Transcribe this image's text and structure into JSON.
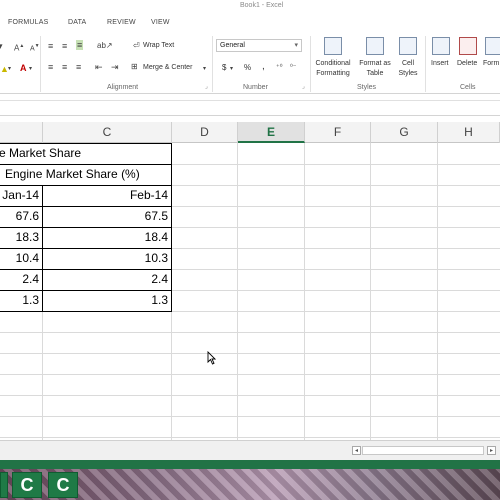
{
  "window": {
    "title": "Book1 - Excel"
  },
  "tabs": [
    "FORMULAS",
    "DATA",
    "REVIEW",
    "VIEW"
  ],
  "ribbon": {
    "alignment": {
      "wrap_text": "Wrap Text",
      "merge_center": "Merge & Center",
      "group_label": "Alignment"
    },
    "number": {
      "format_value": "General",
      "currency": "$",
      "percent": "%",
      "comma": ",",
      "group_label": "Number"
    },
    "styles": {
      "conditional_formatting": [
        "Conditional",
        "Formatting"
      ],
      "format_as_table": [
        "Format as",
        "Table"
      ],
      "cell_styles": [
        "Cell",
        "Styles"
      ],
      "group_label": "Styles"
    },
    "cells": {
      "insert": "Insert",
      "delete": "Delete",
      "format": "Form",
      "group_label": "Cells"
    }
  },
  "columns": [
    "C",
    "D",
    "E",
    "F",
    "G",
    "H"
  ],
  "selected_column": "E",
  "sheet": {
    "title": "e Market Share",
    "subtitle": "Engine Market Share (%)",
    "headers": [
      "Jan-14",
      "Feb-14"
    ],
    "rows": [
      [
        "67.6",
        "67.5"
      ],
      [
        "18.3",
        "18.4"
      ],
      [
        "10.4",
        "10.3"
      ],
      [
        "2.4",
        "2.4"
      ],
      [
        "1.3",
        "1.3"
      ]
    ]
  },
  "taskbar": {
    "apps": [
      "C",
      "C"
    ]
  },
  "colors": {
    "accent": "#217346",
    "grid": "#dadada",
    "header_bg": "#f3f3f3"
  }
}
